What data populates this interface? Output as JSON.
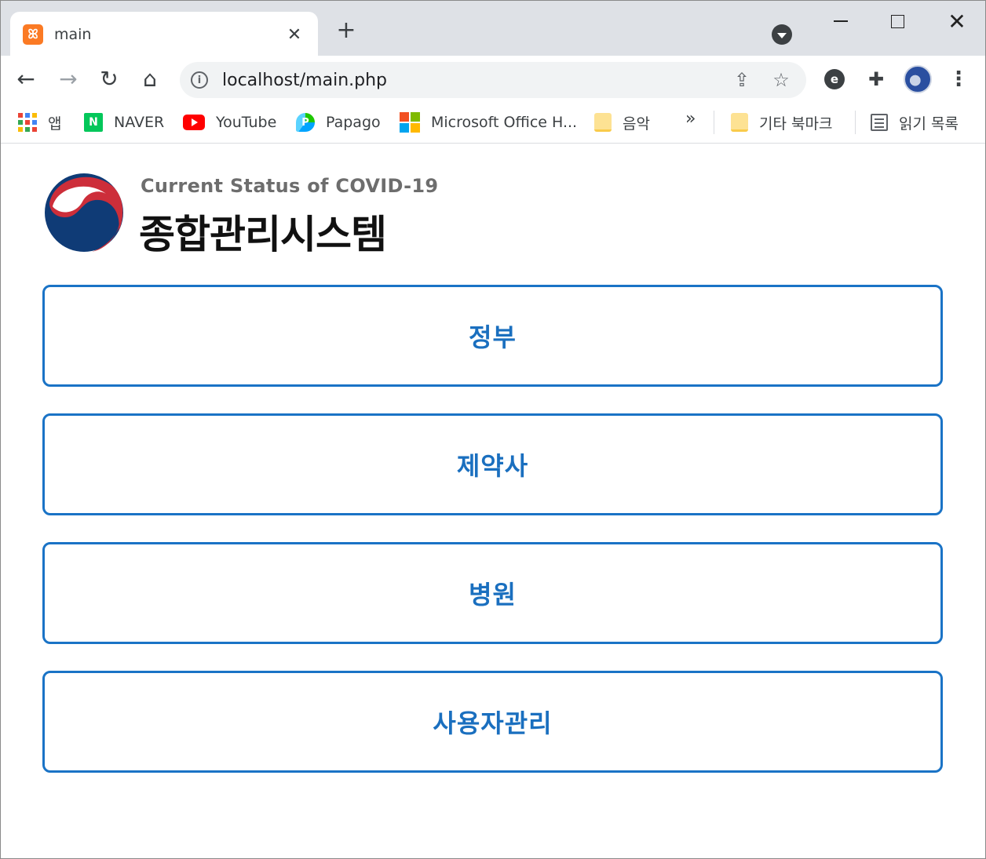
{
  "browser": {
    "tab": {
      "title": "main"
    },
    "address": {
      "url": "localhost/main.php"
    },
    "bookmarks": [
      {
        "label": "앱"
      },
      {
        "label": "NAVER"
      },
      {
        "label": "YouTube"
      },
      {
        "label": "Papago"
      },
      {
        "label": "Microsoft Office H..."
      },
      {
        "label": "음악"
      },
      {
        "label": "기타 북마크"
      },
      {
        "label": "읽기 목록"
      }
    ],
    "overflow": "»"
  },
  "page": {
    "subtitle": "Current Status of COVID-19",
    "title": "종합관리시스템",
    "menu": [
      {
        "label": "정부"
      },
      {
        "label": "제약사"
      },
      {
        "label": "병원"
      },
      {
        "label": "사용자관리"
      }
    ]
  },
  "colors": {
    "accent": "#1a73c6",
    "emblem_red": "#cd2e3a",
    "emblem_blue": "#0f3b76"
  }
}
